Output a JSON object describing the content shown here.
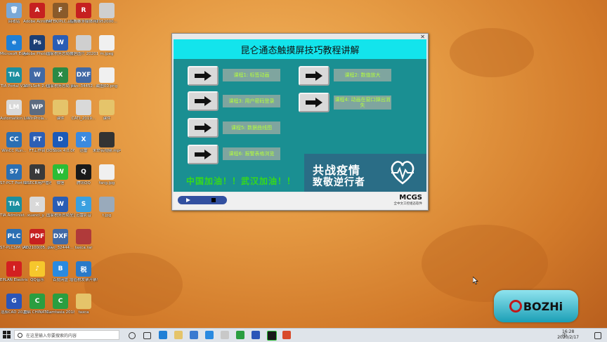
{
  "desktop_icons": [
    {
      "label": "回收站",
      "color": "#7aa8d6",
      "glyph": "🗑"
    },
    {
      "label": "Microsoft Edge",
      "color": "#1f7fd6",
      "glyph": "e"
    },
    {
      "label": "TIA Portal V16",
      "color": "#1b8fa0",
      "glyph": "TIA"
    },
    {
      "label": "Automation License M...",
      "color": "#d9d9d9",
      "glyph": "LM"
    },
    {
      "label": "WinCC Run...",
      "color": "#2b6fb3",
      "glyph": "CC"
    },
    {
      "label": "S7-PCT Port Confi...",
      "color": "#2b6fb3",
      "glyph": "S7"
    },
    {
      "label": "TIA Administ...",
      "color": "#1b8fa0",
      "glyph": "TIA"
    },
    {
      "label": "S7-PLCSIM V16",
      "color": "#2b6fb3",
      "glyph": "PLC"
    },
    {
      "label": "EPLAN Electric...",
      "color": "#d32020",
      "glyph": "!"
    },
    {
      "label": "浩辰CAD 2020",
      "color": "#2b55b8",
      "glyph": "G"
    },
    {
      "label": "Adobe Acrobat...",
      "color": "#c62020",
      "glyph": "A"
    },
    {
      "label": "Adobe Photosh...",
      "color": "#1c3f75",
      "glyph": "Ps"
    },
    {
      "label": "WPLSoft 2.49",
      "color": "#4169a5",
      "glyph": "W"
    },
    {
      "label": "WinProla...",
      "color": "#5c6b80",
      "glyph": "WP"
    },
    {
      "label": "FT工作台",
      "color": "#2c5fb5",
      "glyph": "FT"
    },
    {
      "label": "NISECR用户管理工具",
      "color": "#3a3a3a",
      "glyph": "N"
    },
    {
      "label": "xuanci_y...",
      "color": "#d9d9d9",
      "glyph": "x"
    },
    {
      "label": "AD2100(05... IP address...",
      "color": "#c62020",
      "glyph": "PDF"
    },
    {
      "label": "QQ音乐",
      "color": "#f6c72c",
      "glyph": "♪"
    },
    {
      "label": "重启 CHINATA...",
      "color": "#2a9e40",
      "glyph": "C"
    },
    {
      "label": "FATEK/PLC工控精灵",
      "color": "#8a5a2a",
      "glyph": "F"
    },
    {
      "label": "国家税务总局全国增值税...",
      "color": "#2a5db5",
      "glyph": "W"
    },
    {
      "label": "国家税务总局 2001...",
      "color": "#2a8a45",
      "glyph": "X"
    },
    {
      "label": "课件",
      "color": "#e5c46a",
      "glyph": ""
    },
    {
      "label": "DOSbox 4.0.06",
      "color": "#1c5ab8",
      "glyph": "D"
    },
    {
      "label": "微信",
      "color": "#2bbd36",
      "glyph": "W"
    },
    {
      "label": "国家税务总局全国增值税...",
      "color": "#2a5db5",
      "glyph": "W"
    },
    {
      "label": "pwc_32444...",
      "color": "#4169a5",
      "glyph": "DXF"
    },
    {
      "label": "百度网盘",
      "color": "#2a8ae0",
      "glyph": "B"
    },
    {
      "label": "Camtasia 2018",
      "color": "#2a9e40",
      "glyph": "C"
    },
    {
      "label": "红蜘蛛多媒体网络",
      "color": "#c62020",
      "glyph": "R"
    },
    {
      "label": "微信图片 20201...",
      "color": "#cfcfcf",
      "glyph": ""
    },
    {
      "label": "pwc_34452...",
      "color": "#4169a5",
      "glyph": "DXF"
    },
    {
      "label": "CATI_2019...",
      "color": "#d9d9d9",
      "glyph": ""
    },
    {
      "label": "迅雷",
      "color": "#3b8ae0",
      "glyph": "X"
    },
    {
      "label": "腾讯QQ",
      "color": "#1a1a1a",
      "glyph": "Q"
    },
    {
      "label": "迅雷影音",
      "color": "#3aa0e0",
      "glyph": "S"
    },
    {
      "label": "taxca.rar",
      "color": "#b03a3a",
      "glyph": ""
    },
    {
      "label": "增值税发票开票软件...",
      "color": "#2a7ac8",
      "glyph": "税"
    },
    {
      "label": "taxca",
      "color": "#e5c46a",
      "glyph": ""
    },
    {
      "label": "2952000...",
      "color": "#cfcfcf",
      "glyph": ""
    },
    {
      "label": "m.jpeg",
      "color": "#f0f0f0",
      "glyph": ""
    },
    {
      "label": "截图00.png",
      "color": "#f0f0f0",
      "glyph": ""
    },
    {
      "label": "课件",
      "color": "#e5c46a",
      "glyph": ""
    },
    {
      "label": "未命名视频.mp4",
      "color": "#333",
      "glyph": ""
    },
    {
      "label": "fang.jpg",
      "color": "#f0f0f0",
      "glyph": ""
    },
    {
      "label": "t.jpg",
      "color": "#9ab",
      "glyph": ""
    }
  ],
  "window": {
    "title": "昆仑通态触摸屏技巧教程讲解",
    "close": "✕",
    "lessons": [
      {
        "label": "课程1: 标签动画"
      },
      {
        "label": "课程2: 数值放大"
      },
      {
        "label": "课程3: 用户密码登录"
      },
      {
        "label": "课程4: 动画在窗口弹出消失"
      },
      {
        "label": "课程5: 数据曲线图"
      },
      {
        "label": "课程6: 报警表格浏览"
      }
    ],
    "banner_line1": "共战疫情",
    "banner_line2": "致敬逆行者",
    "slogan": "中国加油！！武汉加油！！",
    "brand": "MCGS",
    "brand_sub": "全中文工控组态软件"
  },
  "logo": {
    "text": "BOZHi"
  },
  "taskbar": {
    "search_placeholder": "在这里输入你要搜索的内容",
    "time": "16:28",
    "date": "2020/2/17",
    "tray_text": "中"
  }
}
